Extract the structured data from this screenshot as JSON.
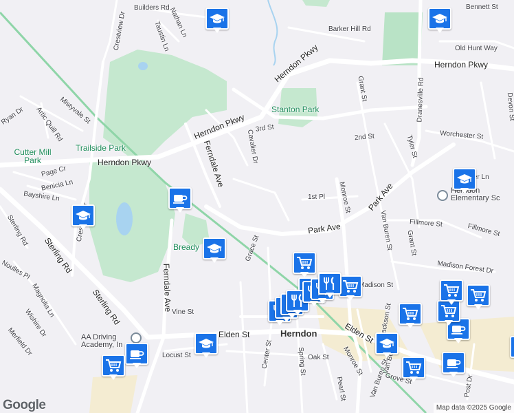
{
  "labels": {
    "roads": [
      "Builders Rd",
      "Nathan Ln",
      "Taustin Ln",
      "Crestview Dr",
      "Barker Hill Rd",
      "Bennett St",
      "Old Hunt Way",
      "Herndon Pkwy",
      "Herndon Pkwy",
      "Herndon Pkwy",
      "Herndon Pkwy",
      "Grant St",
      "Dranesville Rd",
      "Devon St",
      "Mistyvale St",
      "Ryan Dr",
      "Artic Quill Rd",
      "3rd St",
      "Cavalier Dr",
      "2nd St",
      "Tyler St",
      "Worchester St",
      "Ferndale Ave",
      "Page Cr",
      "Benicia Ln",
      "Bayshire Ln",
      "1st Pl",
      "Monroe St",
      "Park Ave",
      "Meyer Ln",
      "Fillmore St",
      "Fillmore St",
      "Van Buren St",
      "Grant St",
      "Park Ave",
      "Grace St",
      "Crestview Dr",
      "Sterling Rd",
      "Sterling Rd",
      "Magnolia Ln",
      "Wishire Dr",
      "Madison Forest Dr",
      "Madison St",
      "Vine St",
      "Ferndale Ave",
      "Elden St",
      "Elden St",
      "Locust St",
      "Oak St",
      "Center St",
      "Spring St",
      "Monroe St",
      "Jackson St",
      "Van Buren St",
      "Pearl St",
      "Grove St",
      "Post Dr",
      "Van Buren St",
      "Noulles Pl",
      "Merfield Dr",
      "Sterling Rd"
    ],
    "parks": [
      "Stanton Park",
      "Trailside Park",
      "Cutter Mill Park",
      "Bready"
    ],
    "places": [
      "Herndon",
      "AA Driving Academy, In",
      "Herndon Elementary Sc"
    ]
  },
  "pins": [
    {
      "icon": "school-icon"
    },
    {
      "icon": "school-icon"
    },
    {
      "icon": "school-icon"
    },
    {
      "icon": "school-icon"
    },
    {
      "icon": "school-icon"
    },
    {
      "icon": "school-icon"
    },
    {
      "icon": "school-icon"
    },
    {
      "icon": "cafe-icon"
    },
    {
      "icon": "cafe-icon"
    },
    {
      "icon": "cafe-icon"
    },
    {
      "icon": "cafe-icon"
    },
    {
      "icon": "cafe-icon"
    },
    {
      "icon": "shopping-cart-icon"
    },
    {
      "icon": "shopping-cart-icon"
    },
    {
      "icon": "shopping-cart-icon"
    },
    {
      "icon": "shopping-cart-icon"
    },
    {
      "icon": "shopping-cart-icon"
    },
    {
      "icon": "shopping-cart-icon"
    },
    {
      "icon": "shopping-cart-icon"
    },
    {
      "icon": "shopping-cart-icon"
    },
    {
      "icon": "shopping-cart-icon"
    },
    {
      "icon": "shopping-cart-icon"
    },
    {
      "icon": "restaurant-icon"
    },
    {
      "icon": "restaurant-icon"
    },
    {
      "icon": "restaurant-icon"
    },
    {
      "icon": "restaurant-icon"
    },
    {
      "icon": "restaurant-icon"
    },
    {
      "icon": "restaurant-icon"
    },
    {
      "icon": "restaurant-icon"
    }
  ],
  "colors": {
    "pin": "#1a73e8",
    "park": "#c5e8cf",
    "road": "#ffffff",
    "rail": "#8fd5a8",
    "water": "#a8d3f0",
    "commercial": "#f4ecd2"
  },
  "brand": "Google",
  "attribution": "Map data ©2025 Google"
}
